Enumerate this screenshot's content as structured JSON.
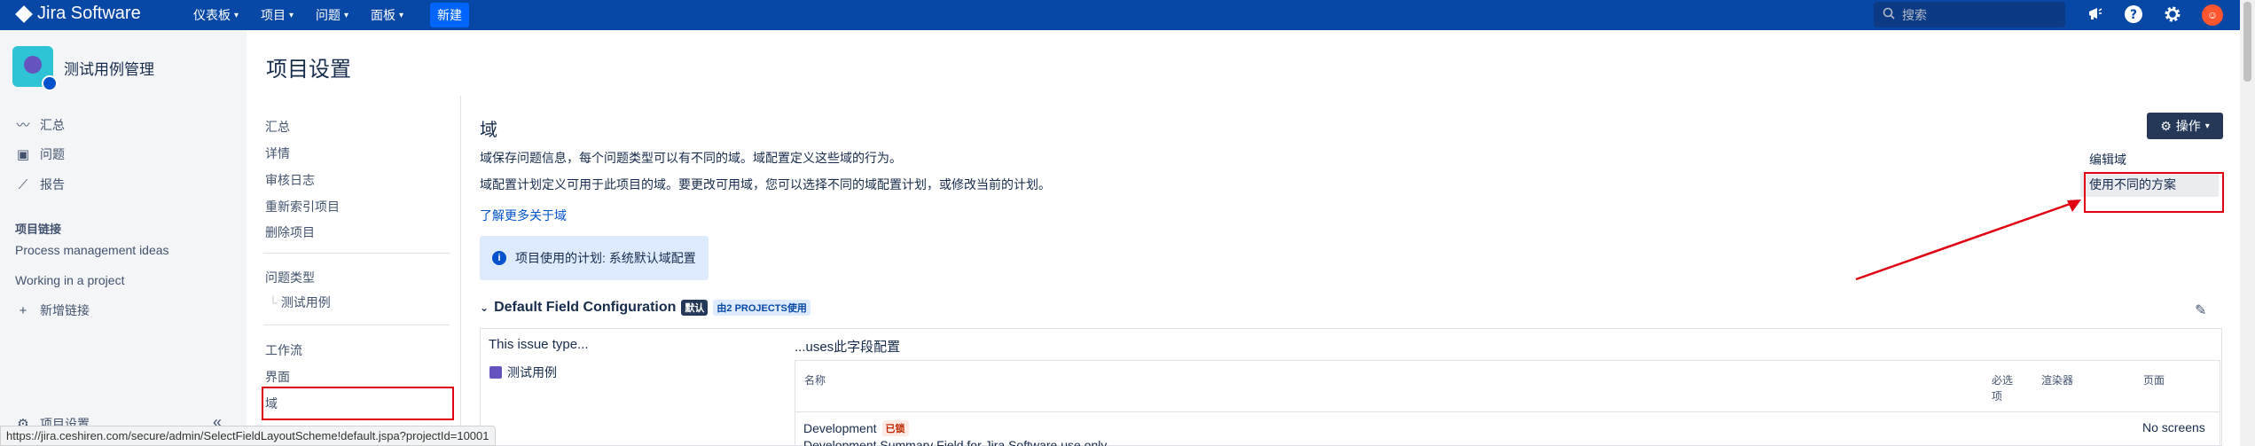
{
  "topbar": {
    "app_name": "Jira Software",
    "nav": [
      {
        "label": "仪表板"
      },
      {
        "label": "项目"
      },
      {
        "label": "问题"
      },
      {
        "label": "面板"
      }
    ],
    "create_label": "新建",
    "search_placeholder": "搜索"
  },
  "project": {
    "name": "测试用例管理",
    "links": [
      {
        "label": "汇总",
        "icon": "activity-icon"
      },
      {
        "label": "问题",
        "icon": "issues-icon"
      },
      {
        "label": "报告",
        "icon": "chart-icon"
      }
    ],
    "project_links_header": "项目链接",
    "project_links": [
      "Process management ideas",
      "Working in a project"
    ],
    "add_link_label": "新增链接",
    "settings_label": "项目设置",
    "collapse_glyph": "«"
  },
  "page": {
    "title": "项目设置"
  },
  "settings_nav": {
    "group1": [
      "汇总",
      "详情",
      "审核日志",
      "重新索引项目",
      "删除项目"
    ],
    "issue_types_label": "问题类型",
    "issue_type_child": "测试用例",
    "group3": [
      "工作流",
      "界面",
      "域"
    ]
  },
  "main": {
    "heading": "域",
    "para1": "域保存问题信息，每个问题类型可以有不同的域。域配置定义这些域的行为。",
    "para2": "域配置计划定义可用于此项目的域。要更改可用域，您可以选择不同的域配置计划，或修改当前的计划。",
    "learn_more": "了解更多关于域",
    "info_text": "项目使用的计划: 系统默认域配置",
    "ops_button": "操作",
    "dropdown": [
      "编辑域",
      "使用不同的方案"
    ],
    "config_title": "Default Field Configuration",
    "default_badge": "默认",
    "used_by_badge": "由2 PROJECTS使用",
    "issue_type_col": "This issue type...",
    "issue_type_value": "测试用例",
    "uses_col": "...uses此字段配置",
    "table_headers": {
      "name": "名称",
      "required": "必选项",
      "renderer": "渲染器",
      "screens": "页面"
    },
    "row": {
      "name": "Development",
      "locked_badge": "已锁",
      "description": "Development Summary Field for Jira Software use only.",
      "screens": "No screens"
    }
  },
  "statusbar": {
    "url": "https://jira.ceshiren.com/secure/admin/SelectFieldLayoutScheme!default.jspa?projectId=10001"
  },
  "colors": {
    "topbar": "#0747a6",
    "create": "#0065ff",
    "annotation_red": "#e00012",
    "link": "#0052cc"
  }
}
